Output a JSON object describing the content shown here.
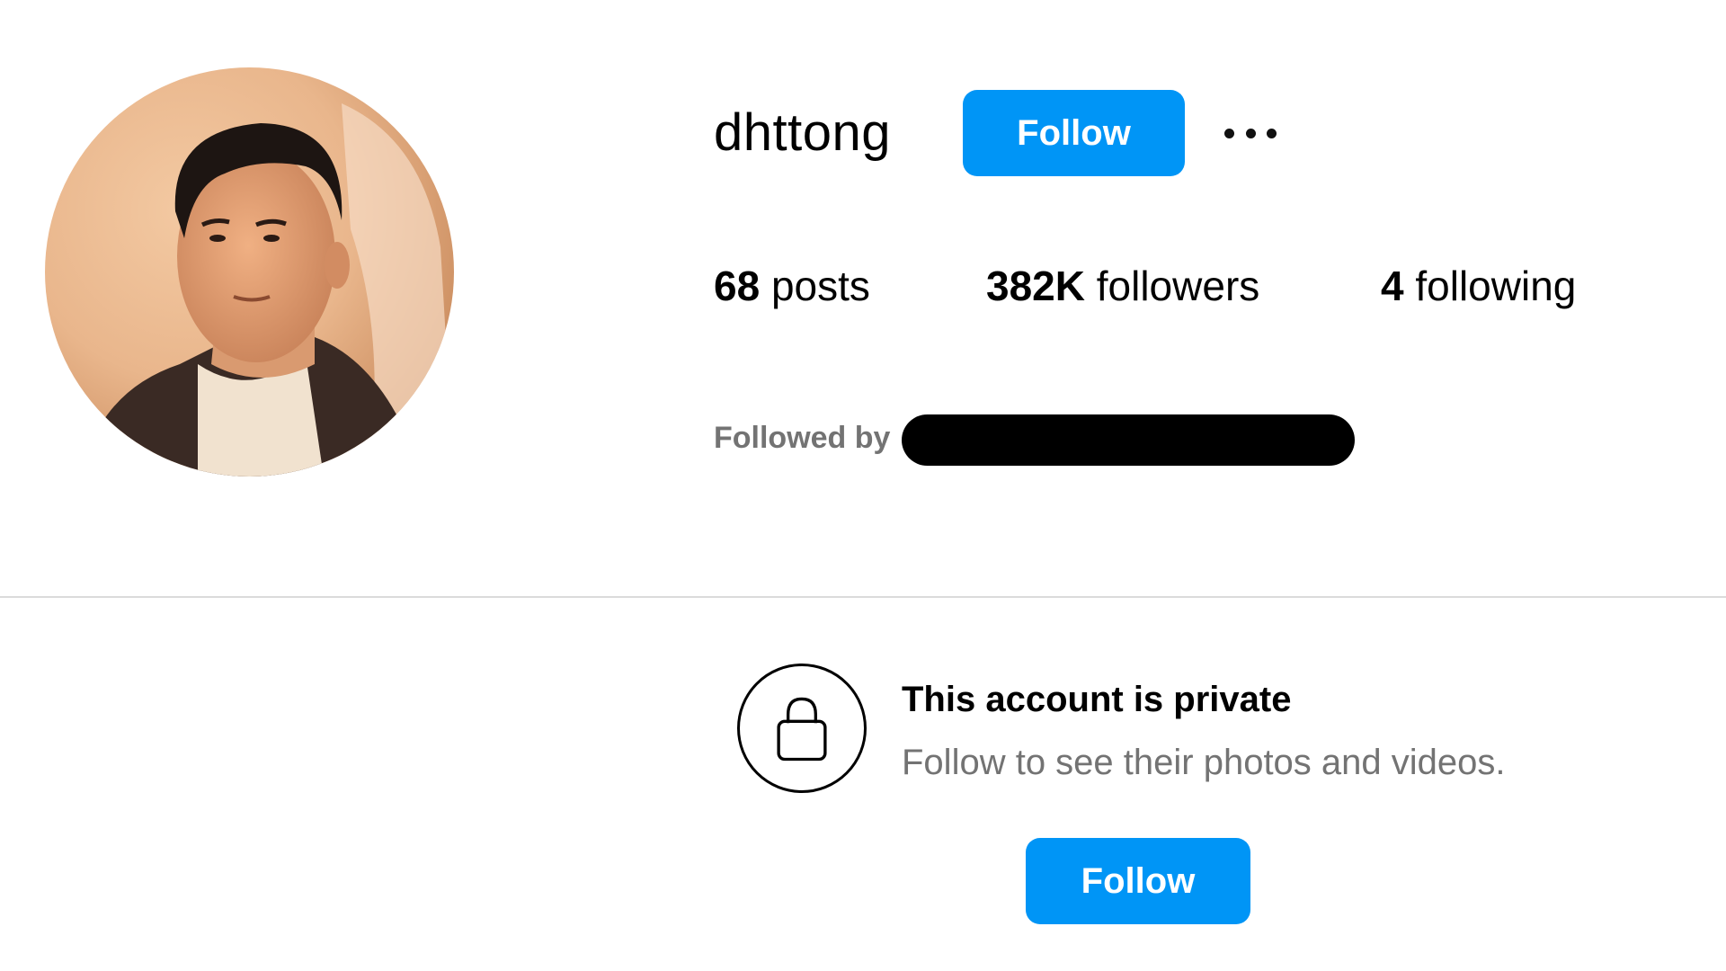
{
  "profile": {
    "username": "dhttong",
    "follow_label": "Follow",
    "more_icon": "more-horizontal-icon",
    "avatar_description_icon": "profile-photo"
  },
  "stats": {
    "posts": {
      "count": "68",
      "label": "posts"
    },
    "followers": {
      "count": "382K",
      "label": "followers"
    },
    "following": {
      "count": "4",
      "label": "following"
    }
  },
  "followed_by": {
    "label": "Followed by"
  },
  "private_notice": {
    "icon": "lock-icon",
    "title": "This account is private",
    "subtitle": "Follow to see their photos and videos.",
    "follow_label": "Follow"
  },
  "colors": {
    "accent": "#0095f6",
    "secondary_text": "#737373",
    "divider": "#dbdbdb"
  }
}
